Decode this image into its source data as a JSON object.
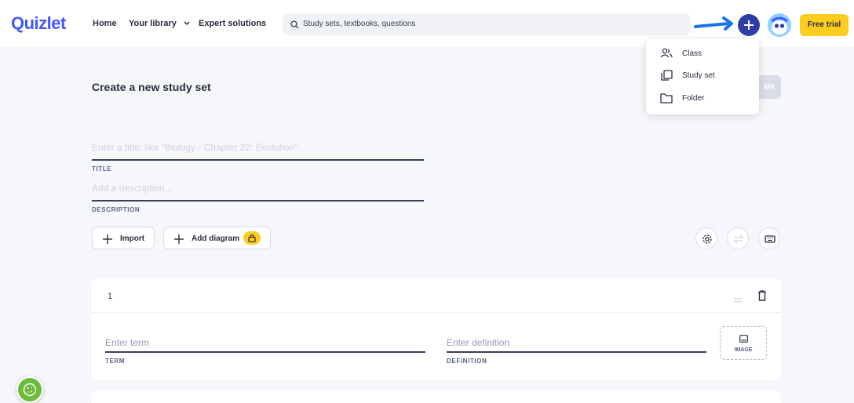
{
  "brand": {
    "logo": "Quizlet",
    "color": "#4255ff"
  },
  "nav": {
    "home": "Home",
    "library": "Your library",
    "expert": "Expert solutions"
  },
  "search": {
    "placeholder": "Study sets, textbooks, questions"
  },
  "header": {
    "trial_label": "Free trial",
    "plus_icon": "plus-icon",
    "avatar_icon": "avatar-icon"
  },
  "menu": {
    "items": [
      {
        "label": "Class",
        "icon": "class-icon"
      },
      {
        "label": "Study set",
        "icon": "study-set-icon"
      },
      {
        "label": "Folder",
        "icon": "folder-icon"
      }
    ]
  },
  "create": {
    "partial_label": "ate"
  },
  "page": {
    "title": "Create a new study set",
    "title_field": {
      "placeholder": "Enter a title, like “Biology - Chapter 22: Evolution”",
      "label": "TITLE"
    },
    "desc_field": {
      "placeholder": "Add a description...",
      "label": "DESCRIPTION"
    },
    "import_label": "Import",
    "diagram_label": "Add diagram"
  },
  "card": {
    "number": "1",
    "term": {
      "placeholder": "Enter term",
      "label": "TERM"
    },
    "definition": {
      "placeholder": "Enter definition",
      "label": "DEFINITION"
    },
    "image_label": "IMAGE"
  },
  "colors": {
    "accent": "#4255ff",
    "plus_bg": "#2e3da8",
    "trial": "#ffcd1f",
    "cookie": "#6dbb3c",
    "annotation_arrow": "#1a73e8"
  }
}
